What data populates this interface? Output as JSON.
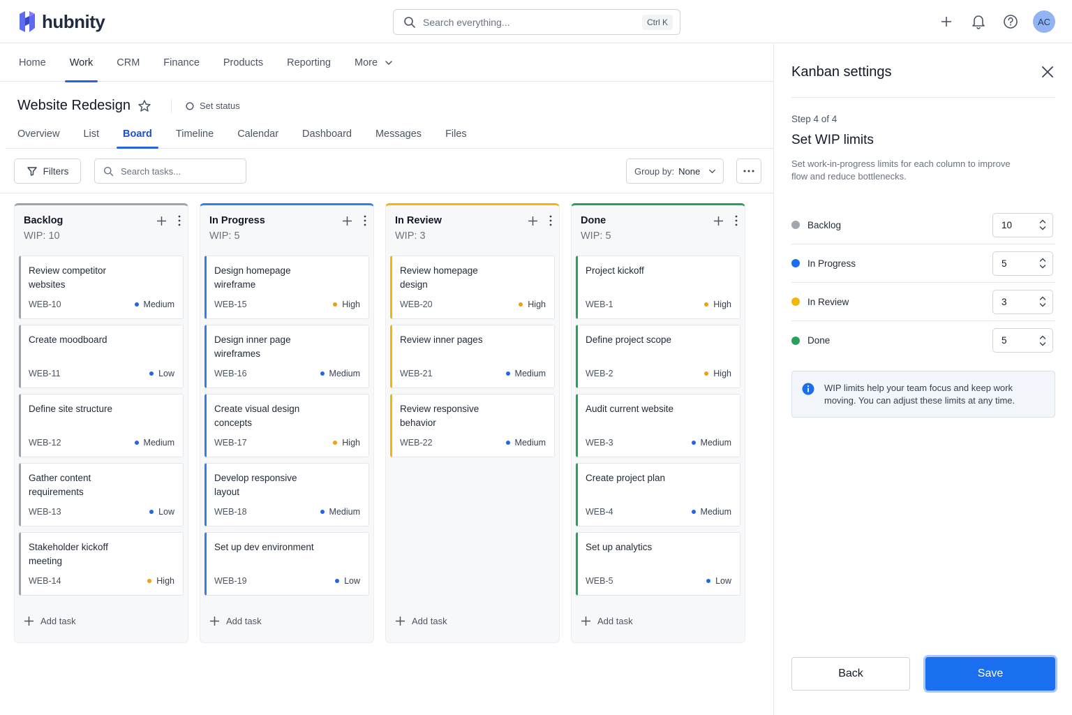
{
  "app": {
    "name": "hubnity",
    "search_placeholder": "Search everything...",
    "search_shortcut": "Ctrl K",
    "avatar_initials": "AC"
  },
  "main_nav": [
    {
      "label": "Home",
      "active": false
    },
    {
      "label": "Work",
      "active": true
    },
    {
      "label": "CRM",
      "active": false
    },
    {
      "label": "Finance",
      "active": false
    },
    {
      "label": "Products",
      "active": false
    },
    {
      "label": "Reporting",
      "active": false
    },
    {
      "label": "More",
      "active": false
    }
  ],
  "project": {
    "title": "Website Redesign",
    "set_status": "Set status"
  },
  "sub_tabs": [
    {
      "label": "Overview",
      "active": false
    },
    {
      "label": "List",
      "active": false
    },
    {
      "label": "Board",
      "active": true
    },
    {
      "label": "Timeline",
      "active": false
    },
    {
      "label": "Calendar",
      "active": false
    },
    {
      "label": "Dashboard",
      "active": false
    },
    {
      "label": "Messages",
      "active": false
    },
    {
      "label": "Files",
      "active": false
    }
  ],
  "toolbar": {
    "filters_label": "Filters",
    "search_placeholder": "Search tasks...",
    "group_by_label": "Group by:",
    "group_by_value": "None"
  },
  "priority_colors": {
    "High": "#f59e0b",
    "Medium": "#2563eb",
    "Low": "#2563eb"
  },
  "columns": [
    {
      "title": "Backlog",
      "wip": "WIP: 10",
      "color": "#9ca3af",
      "add_label": "Add task",
      "cards": [
        {
          "title": "Review competitor websites",
          "id": "WEB-10",
          "priority": "Medium"
        },
        {
          "title": "Create moodboard",
          "id": "WEB-11",
          "priority": "Low"
        },
        {
          "title": "Define site structure",
          "id": "WEB-12",
          "priority": "Medium"
        },
        {
          "title": "Gather content requirements",
          "id": "WEB-13",
          "priority": "Low"
        },
        {
          "title": "Stakeholder kickoff meeting",
          "id": "WEB-14",
          "priority": "High"
        }
      ]
    },
    {
      "title": "In Progress",
      "wip": "WIP: 5",
      "color": "#2f80ed",
      "add_label": "Add task",
      "cards": [
        {
          "title": "Design homepage wireframe",
          "id": "WEB-15",
          "priority": "High"
        },
        {
          "title": "Design inner page wireframes",
          "id": "WEB-16",
          "priority": "Medium"
        },
        {
          "title": "Create visual design concepts",
          "id": "WEB-17",
          "priority": "High"
        },
        {
          "title": "Develop responsive layout",
          "id": "WEB-18",
          "priority": "Medium"
        },
        {
          "title": "Set up dev environment",
          "id": "WEB-19",
          "priority": "Low"
        }
      ]
    },
    {
      "title": "In Review",
      "wip": "WIP: 3",
      "color": "#f2b705",
      "add_label": "Add task",
      "cards": [
        {
          "title": "Review homepage design",
          "id": "WEB-20",
          "priority": "High"
        },
        {
          "title": "Review inner pages",
          "id": "WEB-21",
          "priority": "Medium"
        },
        {
          "title": "Review responsive behavior",
          "id": "WEB-22",
          "priority": "Medium"
        }
      ]
    },
    {
      "title": "Done",
      "wip": "WIP: 5",
      "color": "#27a05a",
      "add_label": "Add task",
      "cards": [
        {
          "title": "Project kickoff",
          "id": "WEB-1",
          "priority": "High"
        },
        {
          "title": "Define project scope",
          "id": "WEB-2",
          "priority": "High"
        },
        {
          "title": "Audit current website",
          "id": "WEB-3",
          "priority": "Medium"
        },
        {
          "title": "Create project plan",
          "id": "WEB-4",
          "priority": "Medium"
        },
        {
          "title": "Set up analytics",
          "id": "WEB-5",
          "priority": "Low"
        }
      ]
    }
  ],
  "panel": {
    "title": "Kanban settings",
    "step": "Step 4 of 4",
    "heading": "Set WIP limits",
    "description": "Set work-in-progress limits for each column to improve flow and reduce bottlenecks.",
    "limits": [
      {
        "label": "Backlog",
        "value": "10",
        "color": "#a3a7ae"
      },
      {
        "label": "In Progress",
        "value": "5",
        "color": "#1a6ff0"
      },
      {
        "label": "In Review",
        "value": "3",
        "color": "#f2b705"
      },
      {
        "label": "Done",
        "value": "5",
        "color": "#27a05a"
      }
    ],
    "info": "WIP limits help your team focus and keep work moving. You can adjust these limits at any time.",
    "back_label": "Back",
    "save_label": "Save"
  }
}
